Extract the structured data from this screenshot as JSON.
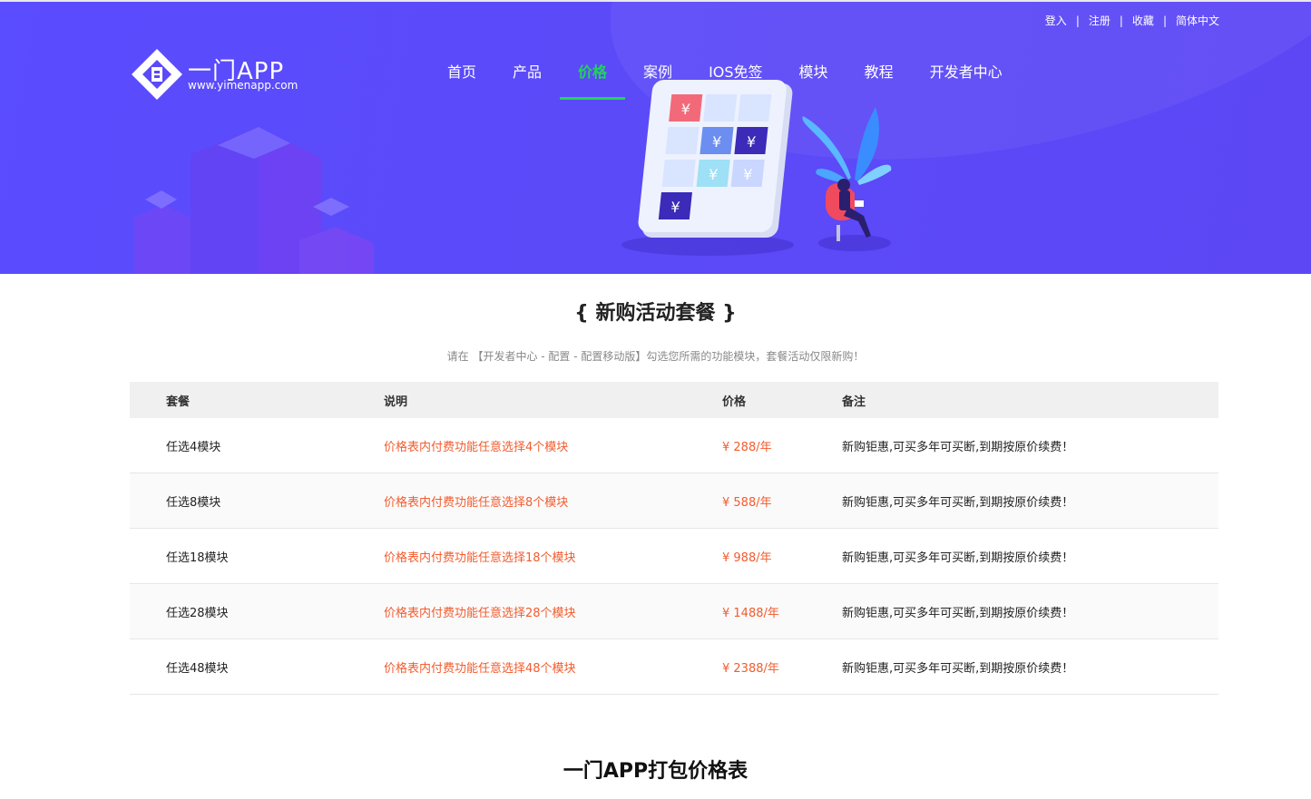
{
  "header": {
    "top_links": [
      "登入",
      "注册",
      "收藏",
      "简体中文"
    ],
    "logo": {
      "brand": "一门APP",
      "url": "www.yimenapp.com"
    },
    "nav": [
      {
        "label": "首页",
        "active": false
      },
      {
        "label": "产品",
        "active": false
      },
      {
        "label": "价格",
        "active": true
      },
      {
        "label": "案例",
        "active": false
      },
      {
        "label": "IOS免签",
        "active": false
      },
      {
        "label": "模块",
        "active": false
      },
      {
        "label": "教程",
        "active": false
      },
      {
        "label": "开发者中心",
        "active": false
      }
    ],
    "illustration_currency": "¥",
    "colors": {
      "background": "#5b4af8",
      "active": "#1fd655"
    }
  },
  "section": {
    "title": "{ 新购活动套餐 }",
    "subtitle": "请在 【开发者中心 - 配置 - 配置移动版】勾选您所需的功能模块，套餐活动仅限新购！"
  },
  "table": {
    "headers": [
      "套餐",
      "说明",
      "价格",
      "备注"
    ],
    "rows": [
      [
        "任选4模块",
        "价格表内付费功能任意选择4个模块",
        "¥ 288/年",
        "新购钜惠,可买多年可买断,到期按原价续费！"
      ],
      [
        "任选8模块",
        "价格表内付费功能任意选择8个模块",
        "¥ 588/年",
        "新购钜惠,可买多年可买断,到期按原价续费！"
      ],
      [
        "任选18模块",
        "价格表内付费功能任意选择18个模块",
        "¥ 988/年",
        "新购钜惠,可买多年可买断,到期按原价续费！"
      ],
      [
        "任选28模块",
        "价格表内付费功能任意选择28个模块",
        "¥ 1488/年",
        "新购钜惠,可买多年可买断,到期按原价续费！"
      ],
      [
        "任选48模块",
        "价格表内付费功能任意选择48个模块",
        "¥ 2388/年",
        "新购钜惠,可买多年可买断,到期按原价续费！"
      ]
    ],
    "colors": {
      "price": "#f25c2e"
    }
  },
  "bottom_title": "一门APP打包价格表"
}
